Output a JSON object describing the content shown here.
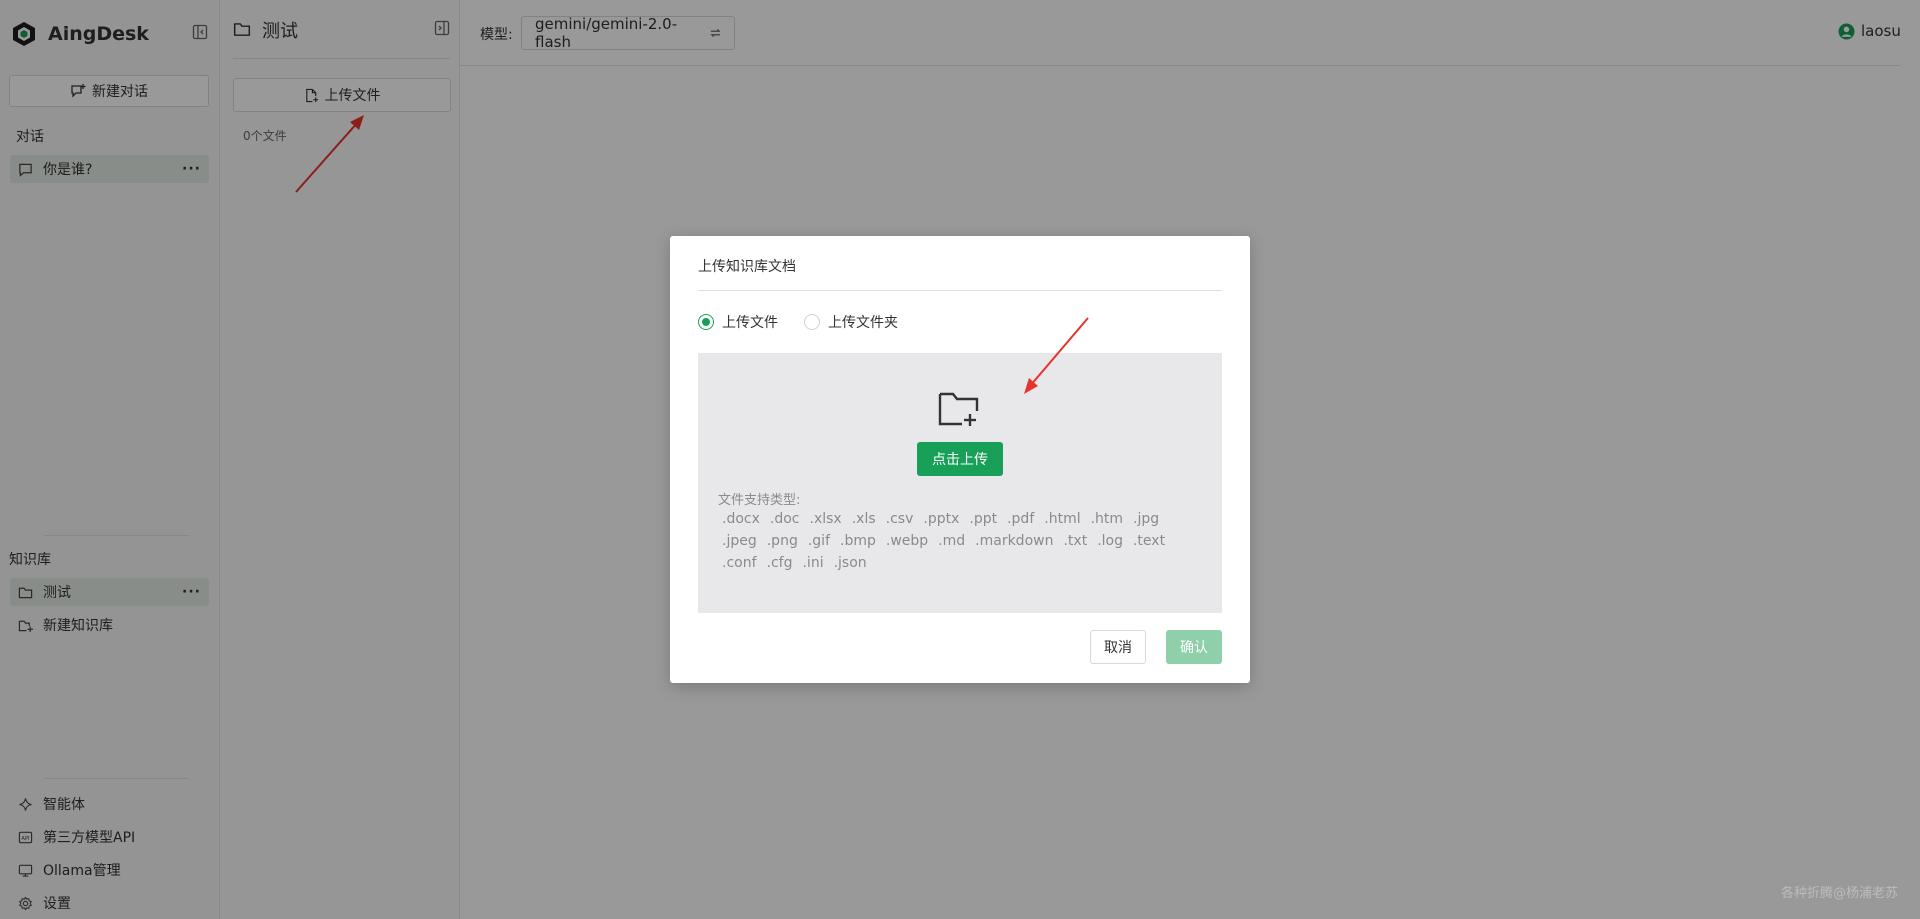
{
  "app": {
    "name": "AingDesk"
  },
  "sidebar": {
    "new_chat_label": "新建对话",
    "chats_title": "对话",
    "chats": [
      {
        "label": "你是谁?"
      }
    ],
    "kb_title": "知识库",
    "knowledge_bases": [
      {
        "label": "测试"
      }
    ],
    "new_kb_label": "新建知识库",
    "bottom": [
      {
        "label": "智能体",
        "icon": "sparkle-icon"
      },
      {
        "label": "第三方模型API",
        "icon": "api-icon"
      },
      {
        "label": "Ollama管理",
        "icon": "monitor-icon"
      },
      {
        "label": "设置",
        "icon": "gear-icon"
      }
    ],
    "more_glyph": "···"
  },
  "kb_panel": {
    "title": "测试",
    "upload_label": "上传文件",
    "file_count": "0个文件"
  },
  "header": {
    "model_label": "模型:",
    "model_value": "gemini/gemini-2.0-flash",
    "user": "laosu"
  },
  "modal": {
    "title": "上传知识库文档",
    "radio_file": "上传文件",
    "radio_folder": "上传文件夹",
    "upload_button": "点击上传",
    "filetypes_label": "文件支持类型:",
    "filetypes": [
      ".docx",
      ".doc",
      ".xlsx",
      ".xls",
      ".csv",
      ".pptx",
      ".ppt",
      ".pdf",
      ".html",
      ".htm",
      ".jpg",
      ".jpeg",
      ".png",
      ".gif",
      ".bmp",
      ".webp",
      ".md",
      ".markdown",
      ".txt",
      ".log",
      ".text",
      ".conf",
      ".cfg",
      ".ini",
      ".json"
    ],
    "cancel": "取消",
    "confirm": "确认"
  },
  "watermark": "各种折腾@杨浦老苏",
  "colors": {
    "accent": "#18a058",
    "accent_disabled": "#8fd0ab",
    "active_item_bg": "#e3ece6",
    "annotation_arrow": "#e8322c"
  }
}
